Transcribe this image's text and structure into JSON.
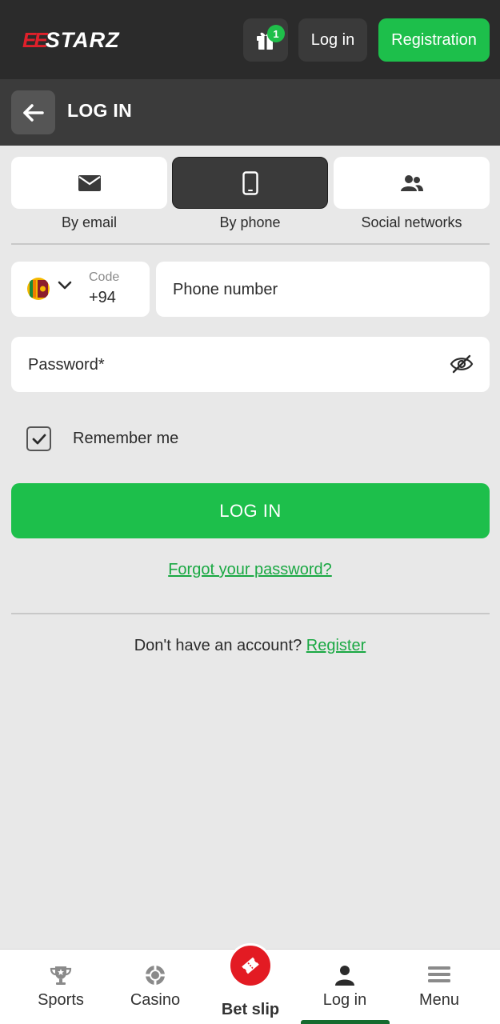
{
  "header": {
    "logo_mark": "EE",
    "logo_text": "STARZ",
    "gift_badge": "1",
    "login_label": "Log in",
    "registration_label": "Registration"
  },
  "subheader": {
    "title": "LOG IN"
  },
  "methods": [
    {
      "label": "By email",
      "icon": "envelope-icon",
      "active": false
    },
    {
      "label": "By phone",
      "icon": "smartphone-icon",
      "active": true
    },
    {
      "label": "Social networks",
      "icon": "people-icon",
      "active": false
    }
  ],
  "form": {
    "country_flag": "sri-lanka-flag-icon",
    "code_label": "Code",
    "code_value": "+94",
    "phone_placeholder": "Phone number",
    "password_placeholder": "Password*",
    "remember_label": "Remember me",
    "remember_checked": true,
    "submit_label": "LOG IN",
    "forgot_label": "Forgot your password?"
  },
  "signup": {
    "prompt": "Don't have an account?",
    "link": "Register"
  },
  "bottom_nav": [
    {
      "label": "Sports",
      "icon": "trophy-icon"
    },
    {
      "label": "Casino",
      "icon": "casino-chip-icon"
    },
    {
      "label": "Bet slip",
      "icon": "ticket-icon"
    },
    {
      "label": "Log in",
      "icon": "user-icon",
      "active": true
    },
    {
      "label": "Menu",
      "icon": "hamburger-menu-icon"
    }
  ],
  "colors": {
    "brand_green": "#1dbf4b",
    "brand_red": "#e31b23",
    "header_dark": "#2b2b2b",
    "page_bg": "#e8e8e8"
  }
}
